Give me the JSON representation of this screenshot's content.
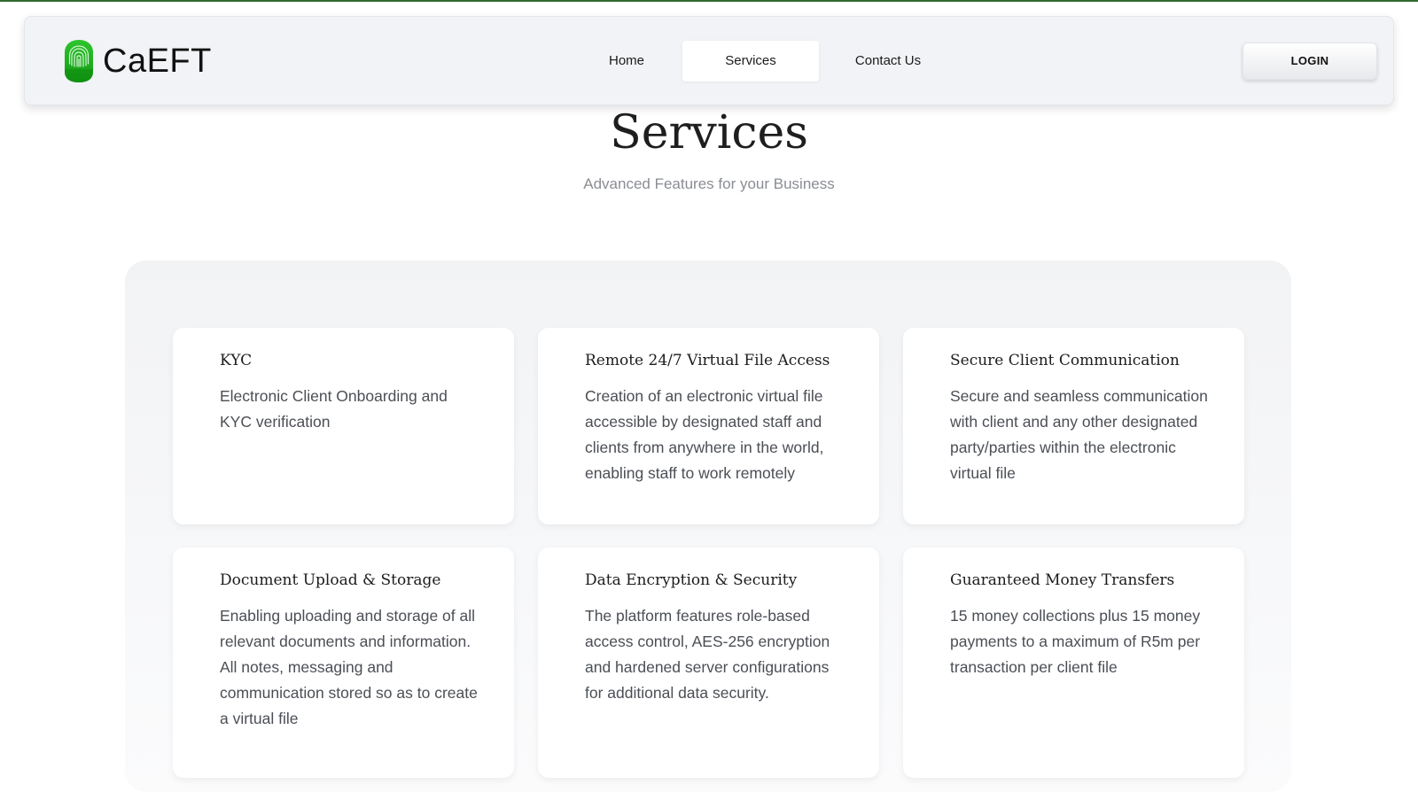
{
  "brand": {
    "name": "CaEFT",
    "logo_icon": "fingerprint-shield-icon",
    "accent_color": "#1fa81f"
  },
  "nav": {
    "items": [
      {
        "label": "Home"
      },
      {
        "label": "Services",
        "active": true
      },
      {
        "label": "Contact Us"
      }
    ],
    "login_label": "LOGIN"
  },
  "page": {
    "title": "Services",
    "subtitle": "Advanced Features for your Business"
  },
  "services": [
    {
      "title": "KYC",
      "description": "Electronic Client Onboarding and KYC verification"
    },
    {
      "title": "Remote 24/7 Virtual File Access",
      "description": "Creation of an electronic virtual file accessible by designated staff and clients from anywhere in the world, enabling staff to work remotely"
    },
    {
      "title": "Secure Client Communication",
      "description": "Secure and seamless communication with client and any other designated party/parties within the electronic virtual file"
    },
    {
      "title": "Document Upload & Storage",
      "description": "Enabling uploading and storage of all relevant documents and information. All notes, messaging and communication stored so as to create a virtual file"
    },
    {
      "title": "Data Encryption & Security",
      "description": "The platform features role-based access control, AES-256 encryption and hardened server configurations for additional data security."
    },
    {
      "title": "Guaranteed Money Transfers",
      "description": "15 money collections plus 15 money payments to a maximum of R5m per transaction per client file"
    }
  ]
}
